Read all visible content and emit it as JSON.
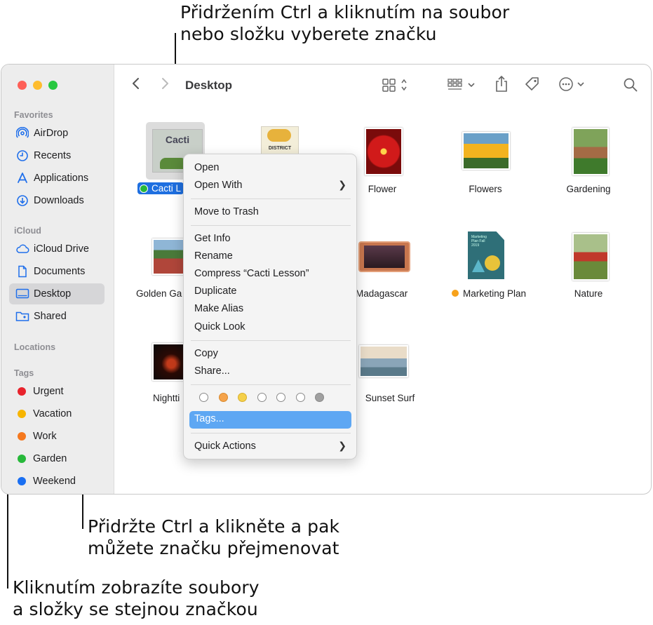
{
  "callouts": {
    "top": [
      "Přidržením Ctrl a kliknutím na soubor",
      "nebo složku vyberete značku"
    ],
    "rename": [
      "Přidržte Ctrl a klikněte a pak",
      "můžete značku přejmenovat"
    ],
    "show": [
      "Kliknutím zobrazíte soubory",
      "a složky se stejnou značkou"
    ]
  },
  "window": {
    "title": "Desktop"
  },
  "sidebar": {
    "favorites_label": "Favorites",
    "favorites": [
      {
        "label": "AirDrop",
        "icon": "airdrop-icon"
      },
      {
        "label": "Recents",
        "icon": "clock-icon"
      },
      {
        "label": "Applications",
        "icon": "applications-icon"
      },
      {
        "label": "Downloads",
        "icon": "download-icon"
      }
    ],
    "icloud_label": "iCloud",
    "icloud": [
      {
        "label": "iCloud Drive",
        "icon": "cloud-icon"
      },
      {
        "label": "Documents",
        "icon": "document-icon"
      },
      {
        "label": "Desktop",
        "icon": "desktop-icon",
        "selected": true
      },
      {
        "label": "Shared",
        "icon": "shared-folder-icon"
      }
    ],
    "locations_label": "Locations",
    "tags_label": "Tags",
    "tags": [
      {
        "label": "Urgent",
        "color": "#e8232c"
      },
      {
        "label": "Vacation",
        "color": "#f7b500"
      },
      {
        "label": "Work",
        "color": "#f5781e"
      },
      {
        "label": "Garden",
        "color": "#27b83a"
      },
      {
        "label": "Weekend",
        "color": "#1a6ff2"
      }
    ]
  },
  "files": [
    {
      "name": "Cacti Lesson",
      "visible_name": "Cacti L",
      "selected": true,
      "tag_color": "#27b83a",
      "thumb_text": "Cacti"
    },
    {
      "name": "District",
      "thumb_text": "DISTRICT"
    },
    {
      "name": "Flower"
    },
    {
      "name": "Flowers"
    },
    {
      "name": "Gardening"
    },
    {
      "name": "Golden Ga"
    },
    {
      "name": "Madagascar",
      "thumb_text": "Madagascar"
    },
    {
      "name": "Marketing Plan",
      "tag_color": "#f7a21c",
      "thumb_text": "Marketing Plan Fall 2019"
    },
    {
      "name": "Nature"
    },
    {
      "name": "Nightti"
    },
    {
      "name": "Sunset Surf"
    }
  ],
  "context_menu": {
    "items": [
      {
        "label": "Open"
      },
      {
        "label": "Open With",
        "submenu": true
      },
      {
        "label": "Move to Trash"
      },
      {
        "label": "Get Info"
      },
      {
        "label": "Rename"
      },
      {
        "label": "Compress “Cacti Lesson”"
      },
      {
        "label": "Duplicate"
      },
      {
        "label": "Make Alias"
      },
      {
        "label": "Quick Look"
      },
      {
        "label": "Copy"
      },
      {
        "label": "Share..."
      },
      {
        "label": "Tags...",
        "highlighted": true
      },
      {
        "label": "Quick Actions",
        "submenu": true
      }
    ],
    "tag_colors": [
      "#ffffff",
      "#f5a34a",
      "#f5d04a",
      "#ffffff",
      "#ffffff",
      "#ffffff",
      "#a0a0a0"
    ]
  }
}
